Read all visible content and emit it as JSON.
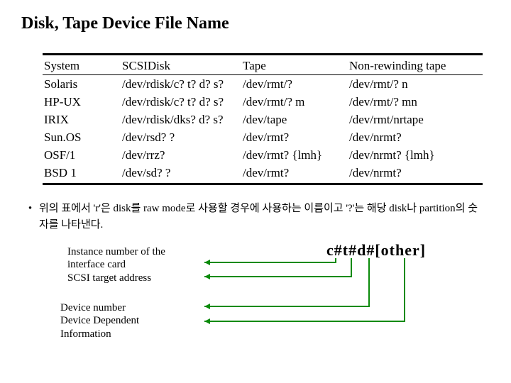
{
  "title": "Disk, Tape Device File Name",
  "table": {
    "headers": {
      "system": "System",
      "scsidisk": "SCSIDisk",
      "tape": "Tape",
      "nonrew": "Non-rewinding tape"
    },
    "rows": [
      {
        "system": "Solaris",
        "scsidisk": "/dev/rdisk/c? t? d? s?",
        "tape": "/dev/rmt/?",
        "nonrew": "/dev/rmt/? n"
      },
      {
        "system": "HP-UX",
        "scsidisk": "/dev/rdisk/c? t? d? s?",
        "tape": "/dev/rmt/? m",
        "nonrew": "/dev/rmt/? mn"
      },
      {
        "system": "IRIX",
        "scsidisk": "/dev/rdisk/dks? d? s?",
        "tape": "/dev/tape",
        "nonrew": "/dev/rmt/nrtape"
      },
      {
        "system": "Sun.OS",
        "scsidisk": "/dev/rsd? ?",
        "tape": "/dev/rmt?",
        "nonrew": "/dev/nrmt?"
      },
      {
        "system": "OSF/1",
        "scsidisk": "/dev/rrz?",
        "tape": "/dev/rmt? {lmh}",
        "nonrew": "/dev/nrmt? {lmh}"
      },
      {
        "system": "BSD 1",
        "scsidisk": "/dev/sd? ?",
        "tape": "/dev/rmt?",
        "nonrew": "/dev/nrmt?"
      }
    ]
  },
  "note": "위의 표에서 'r'은 disk를 raw mode로 사용할 경우에 사용하는 이름이고 '?'는 해당 disk나 partition의 숫자를 나타낸다.",
  "diagram": {
    "format": {
      "c": "c#",
      "t": "t#",
      "d": "d#",
      "other": "[other]"
    },
    "labels": {
      "instance1": "Instance number of the",
      "instance2": "interface card",
      "scsitarget": "SCSI target address",
      "devnum": "Device  number",
      "devdep1": "Device Dependent",
      "devdep2": "Information"
    }
  }
}
